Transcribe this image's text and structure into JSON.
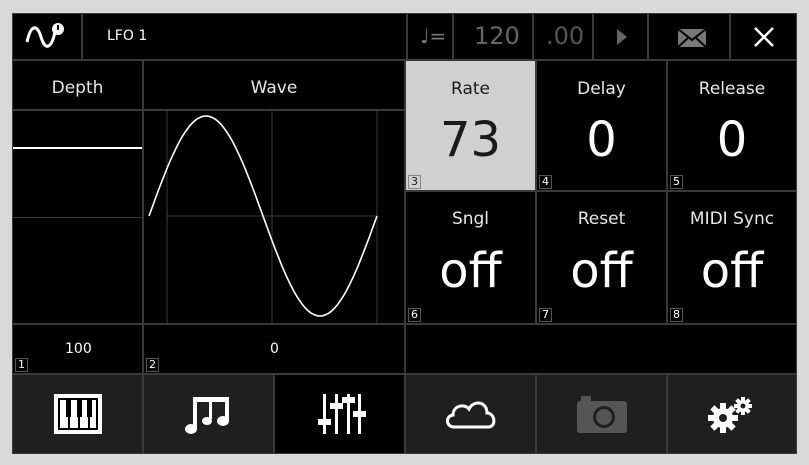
{
  "header": {
    "title": "LFO 1",
    "tempo_value": "120",
    "tempo_decimal": ".00"
  },
  "params": {
    "depth": {
      "label": "Depth",
      "value": "100",
      "index": "1"
    },
    "wave": {
      "label": "Wave",
      "value": "0",
      "index": "2"
    },
    "rate": {
      "label": "Rate",
      "value": "73",
      "index": "3"
    },
    "delay": {
      "label": "Delay",
      "value": "0",
      "index": "4"
    },
    "release": {
      "label": "Release",
      "value": "0",
      "index": "5"
    },
    "sngl": {
      "label": "Sngl",
      "value": "off",
      "index": "6"
    },
    "reset": {
      "label": "Reset",
      "value": "off",
      "index": "7"
    },
    "midi_sync": {
      "label": "MIDI Sync",
      "value": "off",
      "index": "8"
    }
  },
  "depth_level": 0.83,
  "tabs": [
    {
      "icon": "piano-keys-icon",
      "active": false
    },
    {
      "icon": "music-notes-icon",
      "active": false
    },
    {
      "icon": "sliders-icon",
      "active": true
    },
    {
      "icon": "cloud-icon",
      "active": false
    },
    {
      "icon": "camera-icon",
      "active": false,
      "disabled": true
    },
    {
      "icon": "gears-icon",
      "active": false
    }
  ],
  "colors": {
    "background": "#000000",
    "selected_cell": "#d0d0d0",
    "frame": "#d9d9d9"
  }
}
